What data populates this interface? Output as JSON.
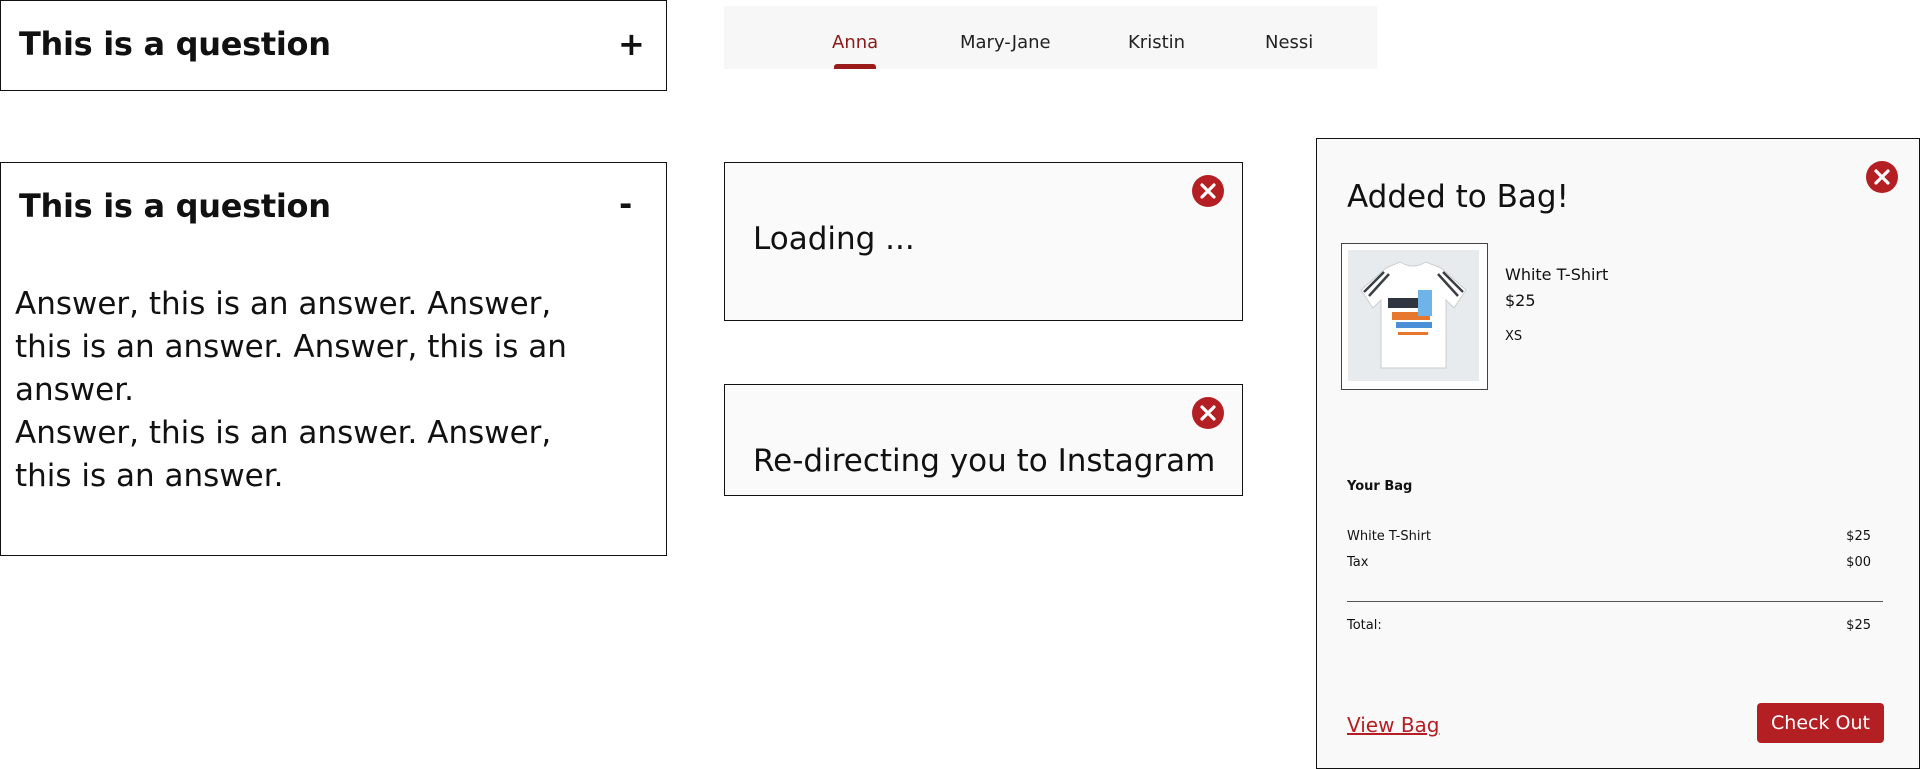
{
  "accordion_collapsed": {
    "question": "This is a question",
    "toggle": "+"
  },
  "accordion_expanded": {
    "question": "This is a question",
    "toggle": "-",
    "answer_lines": [
      "Answer,  this is an answer.  Answer,",
      "this is an answer. Answer,  this is an answer.",
      "Answer,  this is an answer. Answer,",
      "this is an answer."
    ]
  },
  "tabs": {
    "items": [
      "Anna",
      "Mary-Jane",
      "Kristin",
      "Nessi"
    ],
    "active": "Anna"
  },
  "toasts": {
    "loading": "Loading ...",
    "redirect": "Re-directing you to Instagram"
  },
  "cart": {
    "title": "Added to Bag!",
    "product": {
      "name": "White T-Shirt",
      "price": "$25",
      "size": "XS"
    },
    "bag_heading": "Your Bag",
    "lines": [
      {
        "label": "White T-Shirt",
        "amount": "$25"
      },
      {
        "label": "Tax",
        "amount": "$00"
      }
    ],
    "total_label": "Total:",
    "total_amount": "$25",
    "view_bag": "View Bag",
    "checkout": "Check Out"
  },
  "colors": {
    "accent": "#b41f24",
    "tab_active": "#8b1a1a"
  },
  "icons": [
    "close-icon",
    "tshirt-image"
  ]
}
